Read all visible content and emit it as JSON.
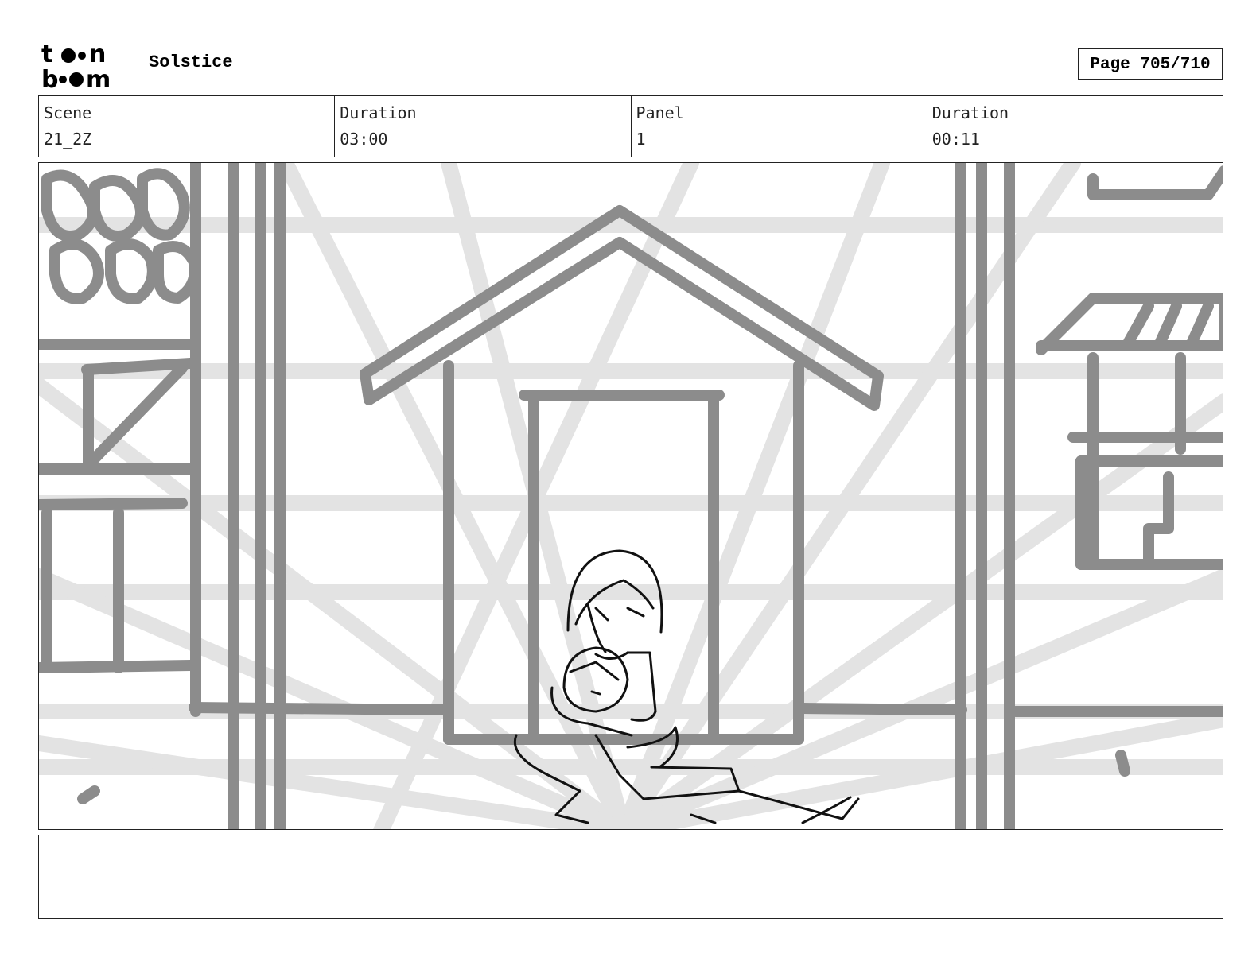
{
  "header": {
    "logo_text": "toon boom",
    "project_title": "Solstice",
    "page_indicator": "Page 705/710"
  },
  "info": {
    "scene_label": "Scene",
    "scene_value": "21_2Z",
    "scene_duration_label": "Duration",
    "scene_duration_value": "03:00",
    "panel_label": "Panel",
    "panel_value": "1",
    "panel_duration_label": "Duration",
    "panel_duration_value": "00:11"
  },
  "panel": {
    "drawing_description": "",
    "caption": ""
  }
}
